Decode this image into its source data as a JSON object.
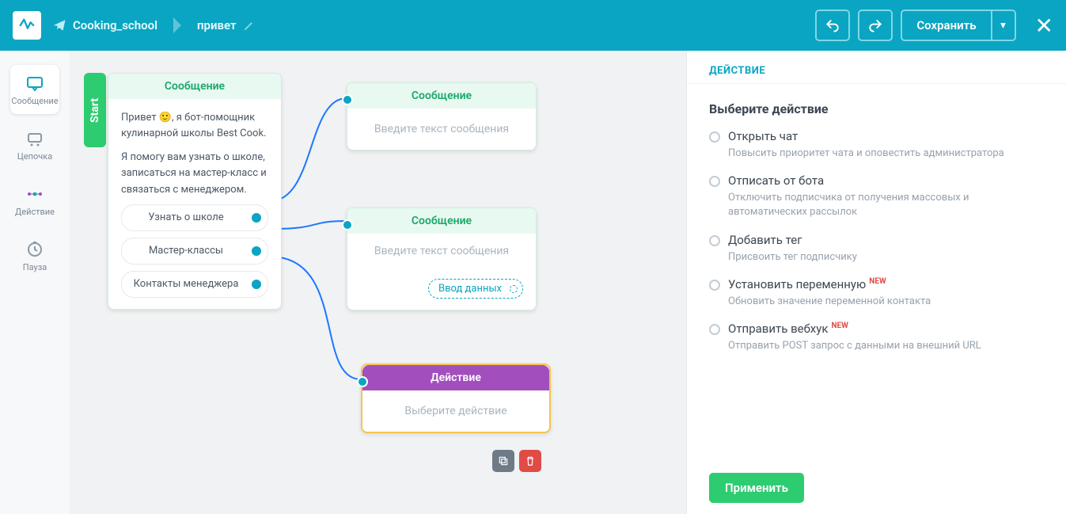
{
  "header": {
    "bot_name": "Cooking_school",
    "flow_name": "привет",
    "save_label": "Сохранить"
  },
  "sidebar": {
    "items": [
      {
        "label": "Сообщение",
        "name": "sidebar-message"
      },
      {
        "label": "Цепочка",
        "name": "sidebar-chain"
      },
      {
        "label": "Действие",
        "name": "sidebar-action"
      },
      {
        "label": "Пауза",
        "name": "sidebar-pause"
      }
    ]
  },
  "canvas": {
    "start_label": "Start",
    "node1": {
      "title": "Сообщение",
      "text_line1": "Привет 🙂, я бот-помощник кулинарной школы Best Cook.",
      "text_line2": "Я помогу вам узнать о школе, записаться на мастер-класс и связаться с менеджером.",
      "options": [
        "Узнать о школе",
        "Мастер-классы",
        "Контакты менеджера"
      ]
    },
    "node2": {
      "title": "Сообщение",
      "placeholder": "Введите текст сообщения"
    },
    "node3": {
      "title": "Сообщение",
      "placeholder": "Введите текст сообщения",
      "chip": "Ввод данных"
    },
    "node4": {
      "title": "Действие",
      "placeholder": "Выберите действие"
    }
  },
  "panel": {
    "header": "ДЕЙСТВИЕ",
    "title": "Выберите действие",
    "actions": [
      {
        "label": "Открыть чат",
        "desc": "Повысить приоритет чата и оповестить администратора",
        "new": false
      },
      {
        "label": "Отписать от бота",
        "desc": "Отключить подписчика от получения массовых и автоматических рассылок",
        "new": false
      },
      {
        "label": "Добавить тег",
        "desc": "Присвоить тег подписчику",
        "new": false
      },
      {
        "label": "Установить переменную",
        "desc": "Обновить значение переменной контакта",
        "new": true
      },
      {
        "label": "Отправить вебхук",
        "desc": "Отправить POST запрос с данными на внешний URL",
        "new": true
      }
    ],
    "new_badge": "NEW",
    "apply": "Применить"
  }
}
